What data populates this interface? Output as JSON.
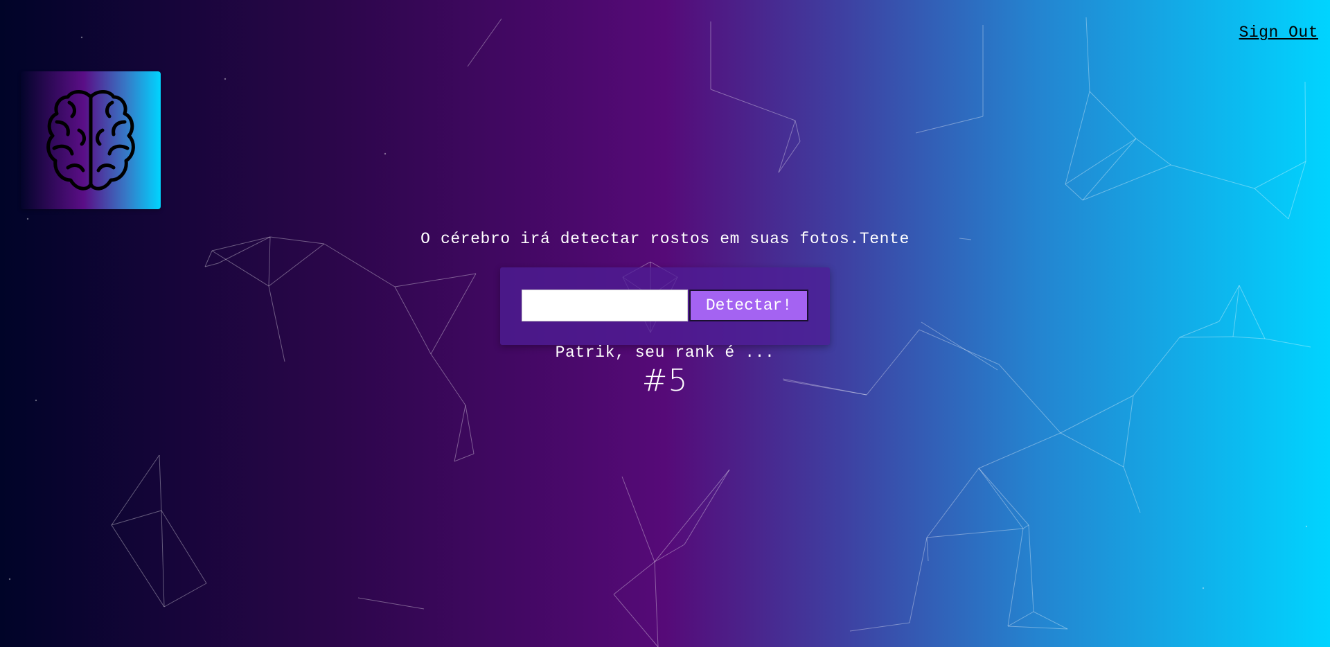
{
  "nav": {
    "sign_out_label": "Sign Out"
  },
  "logo": {
    "icon": "brain-icon"
  },
  "main": {
    "headline": "O cérebro irá detectar rostos em suas fotos.Tente",
    "image_url_input": {
      "value": "",
      "placeholder": ""
    },
    "detect_button_label": "Detectar!",
    "rank_text": "Patrik, seu rank é ...",
    "rank_value": "#5"
  },
  "colors": {
    "gradient_left": "#000428",
    "gradient_mid": "#560a78",
    "gradient_right": "#00d4ff",
    "button_bg": "#a463f2",
    "text": "#ffffff"
  }
}
